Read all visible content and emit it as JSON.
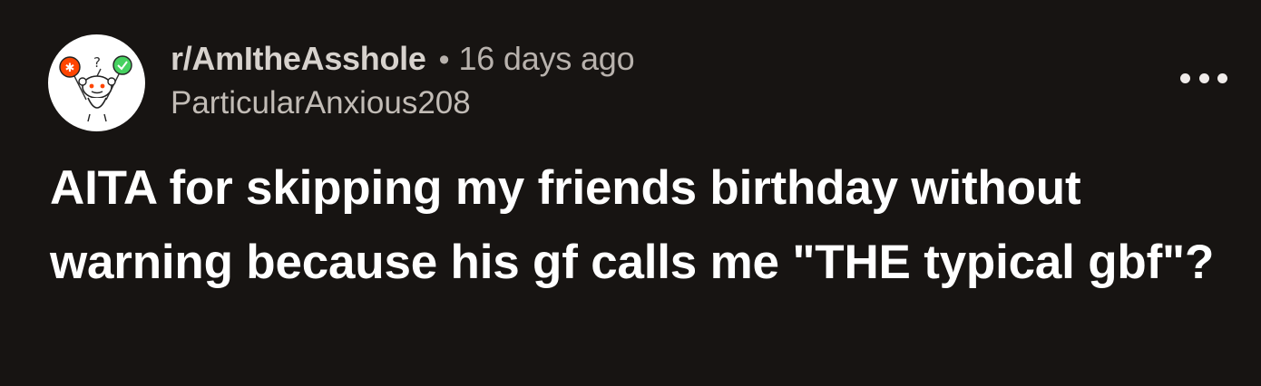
{
  "post": {
    "subreddit": "r/AmItheAsshole",
    "separator": "•",
    "time_ago": "16 days ago",
    "username": "ParticularAnxious208",
    "title": "AITA for skipping my friends birthday without warning because his gf calls me \"THE typical gbf\"?",
    "avatar_icon": "snoo-avatar-icon",
    "more_icon": "more-options-icon"
  },
  "colors": {
    "background": "#171412",
    "title_text": "#ffffff",
    "meta_text": "#b8b2ad",
    "avatar_background": "#ffffff"
  }
}
